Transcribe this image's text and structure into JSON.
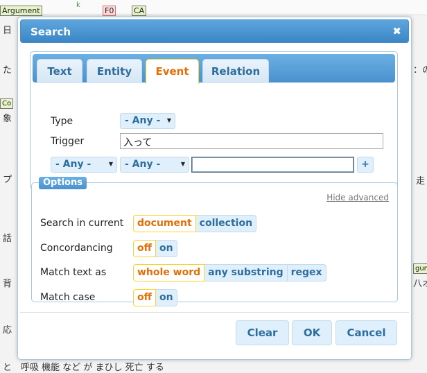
{
  "background": {
    "top_tags": [
      "Argument",
      "k",
      "F0",
      "CA"
    ],
    "fragments": {
      "left_1": "日",
      "left_2": "た",
      "left_3": "Co",
      "left_4": "象",
      "left_5": "プ",
      "left_6": "話",
      "left_7": "背",
      "left_8": "応",
      "right_1": "：の",
      "right_2": "走",
      "right_3": "gun",
      "right_4": "八オ",
      "bottom": "と　呼吸 機能 など が まひし 死亡 する"
    }
  },
  "dialog": {
    "title": "Search",
    "close_glyph": "✖",
    "tabs": [
      {
        "label": "Text",
        "active": false
      },
      {
        "label": "Entity",
        "active": false
      },
      {
        "label": "Event",
        "active": true
      },
      {
        "label": "Relation",
        "active": false
      }
    ],
    "event_form": {
      "type_label": "Type",
      "type_value": "- Any -",
      "trigger_label": "Trigger",
      "trigger_value": "入って",
      "arg_role_value": "- Any -",
      "arg_type_value": "- Any -",
      "arg_text_value": "",
      "add_label": "+"
    },
    "options": {
      "legend": "Options",
      "hide_advanced": "Hide advanced",
      "search_in_label": "Search in current",
      "search_in_options": [
        "document",
        "collection"
      ],
      "search_in_selected": "document",
      "concordancing_label": "Concordancing",
      "concordancing_options": [
        "off",
        "on"
      ],
      "concordancing_selected": "off",
      "match_text_label": "Match text as",
      "match_text_options": [
        "whole word",
        "any substring",
        "regex"
      ],
      "match_text_selected": "whole word",
      "match_case_label": "Match case",
      "match_case_options": [
        "off",
        "on"
      ],
      "match_case_selected": "off"
    },
    "buttons": {
      "clear": "Clear",
      "ok": "OK",
      "cancel": "Cancel"
    }
  },
  "colors": {
    "accent_blue": "#2e6e9e",
    "selected_orange": "#e17009",
    "titlebar": "#4a92cf"
  }
}
